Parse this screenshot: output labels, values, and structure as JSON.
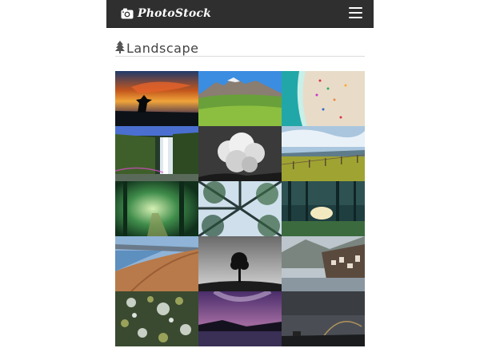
{
  "app": {
    "brand_name": "PhotoStock",
    "brand_icon": "camera-icon",
    "menu_icon": "hamburger-menu-icon"
  },
  "section": {
    "icon": "tree-icon",
    "title": "Landscape"
  },
  "colors": {
    "navbar": "#2f2f2f",
    "heading_text": "#444444",
    "divider": "#dcdcdc"
  },
  "gallery": {
    "photos": [
      {
        "subject": "sunset-silhouette"
      },
      {
        "subject": "mountain-meadow"
      },
      {
        "subject": "aerial-beach"
      },
      {
        "subject": "waterfall"
      },
      {
        "subject": "bw-cloud"
      },
      {
        "subject": "field-fence"
      },
      {
        "subject": "misty-forest-path"
      },
      {
        "subject": "looking-up-trees"
      },
      {
        "subject": "forest-sunlight"
      },
      {
        "subject": "dirt-road-lake"
      },
      {
        "subject": "lone-tree"
      },
      {
        "subject": "lakeside-village"
      },
      {
        "subject": "lichen-rocks"
      },
      {
        "subject": "night-sky-lake"
      },
      {
        "subject": "storm-rainbow"
      }
    ]
  }
}
